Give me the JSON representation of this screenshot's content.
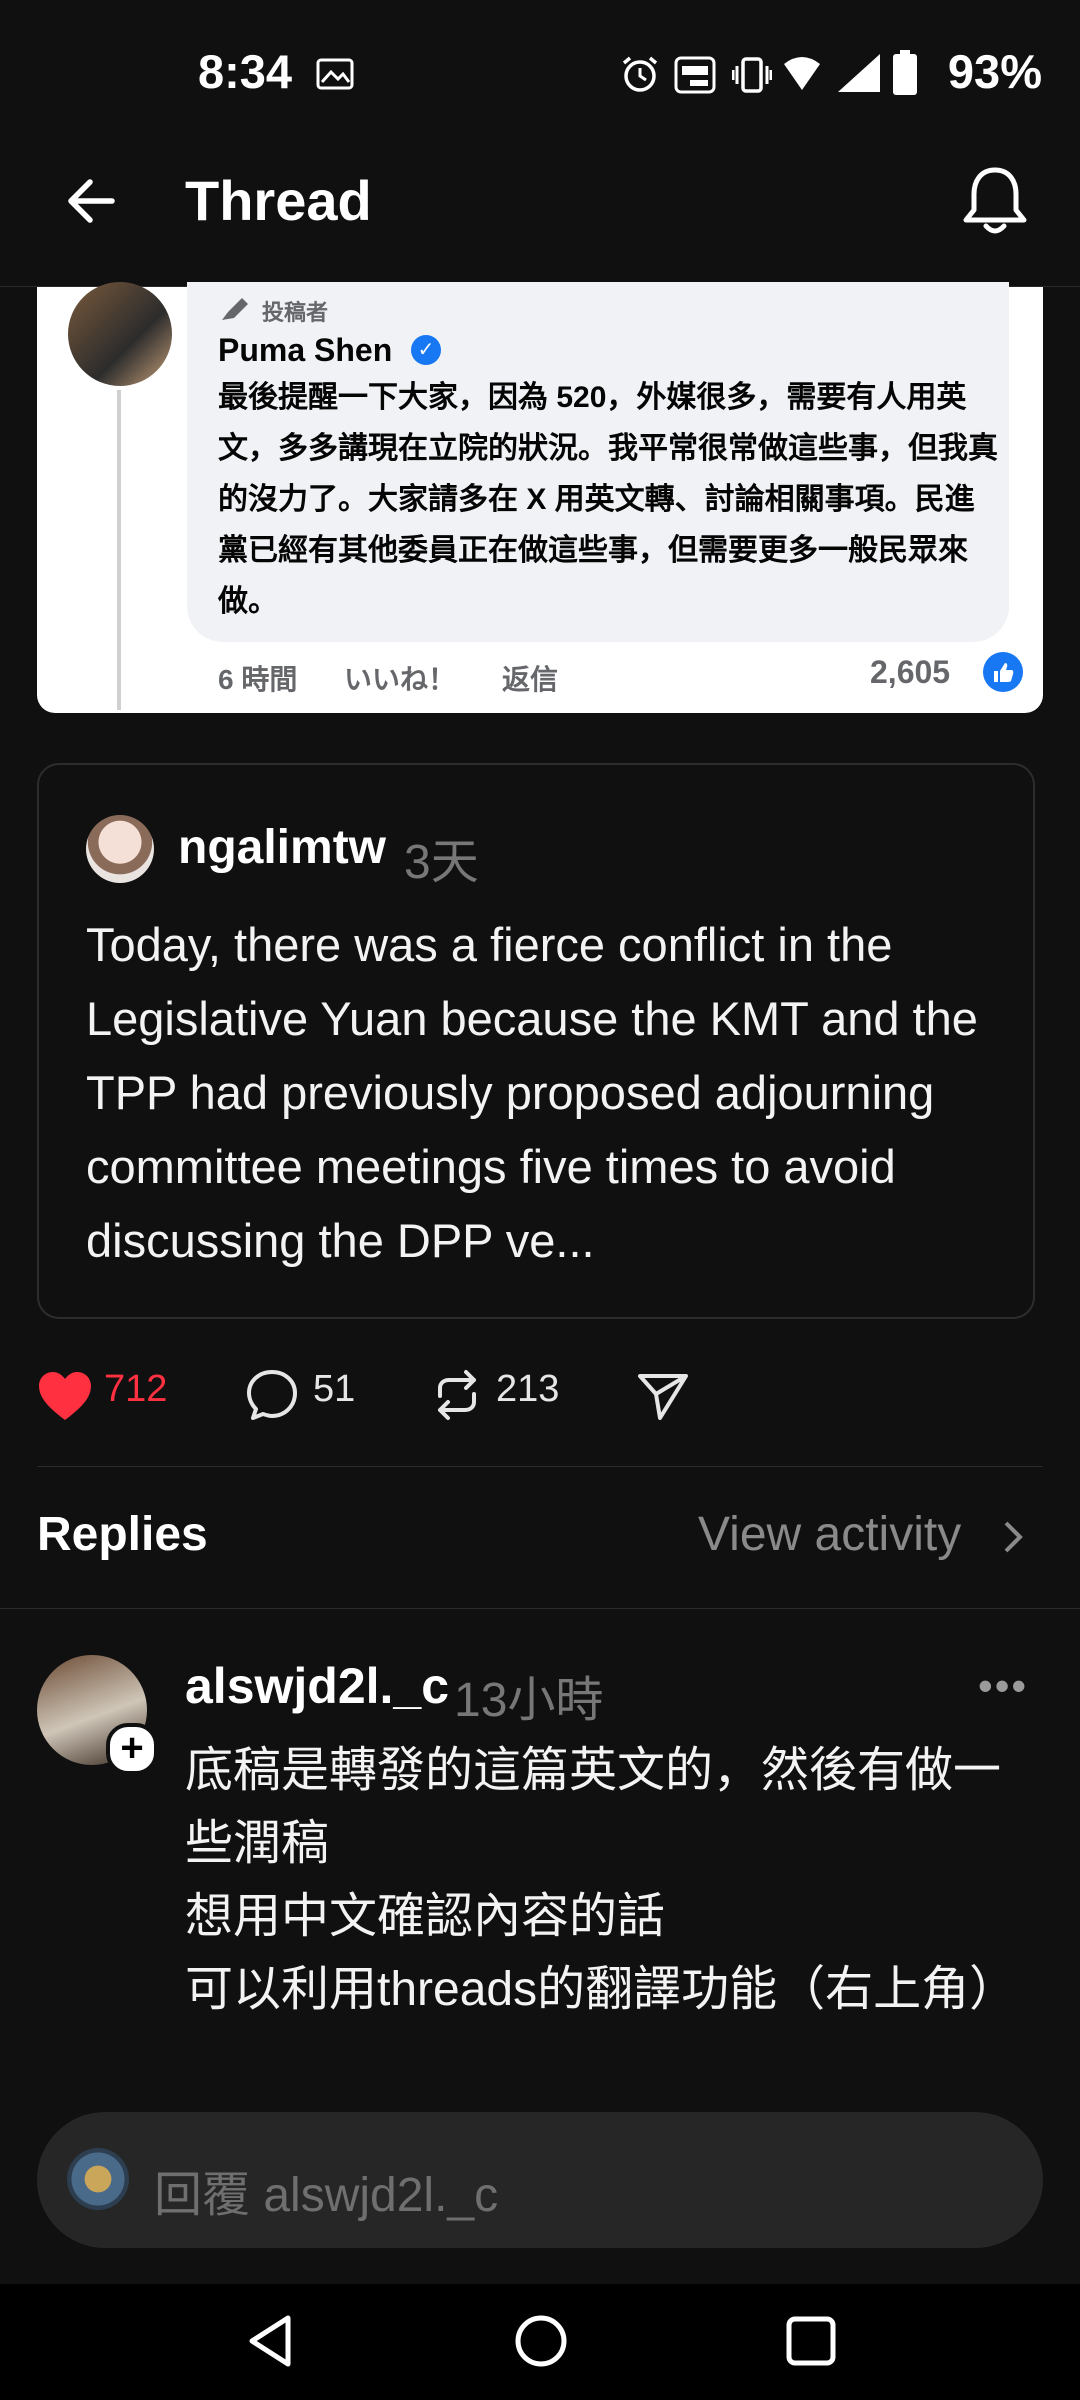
{
  "status_bar": {
    "time": "8:34",
    "battery_percent": "93%",
    "icons": [
      "image-icon",
      "alarm-icon",
      "auto-hz-icon",
      "vibrate-icon",
      "wifi-icon",
      "signal-icon",
      "battery-icon"
    ]
  },
  "app_bar": {
    "title": "Thread",
    "back_icon": "arrow-left-icon",
    "notify_icon": "bell-icon"
  },
  "embedded_post": {
    "poster_tag": "投稿者",
    "name": "Puma Shen",
    "text": "最後提醒一下大家，因為 520，外媒很多，需要有人用英文，多多講現在立院的狀況。我平常很常做這些事，但我真的沒力了。大家請多在 X 用英文轉、討論相關事項。民進黨已經有其他委員正在做這些事，但需要更多一般民眾來做。",
    "time": "6 時間",
    "like_label": "いいね！",
    "reply_label": "返信",
    "reaction_count": "2,605"
  },
  "quoted_post": {
    "username": "ngalimtw",
    "age": "3天",
    "text": "Today, there was a fierce conflict in the Legislative Yuan because the KMT and the TPP had previously proposed adjourning committee meetings five times to avoid discussing the DPP ve..."
  },
  "actions": {
    "likes": "712",
    "comments": "51",
    "reposts": "213",
    "liked": true
  },
  "replies_header": {
    "label": "Replies",
    "view_activity": "View activity"
  },
  "reply": {
    "username": "alswjd2l._c",
    "age": "13小時",
    "more": "•••",
    "lines": [
      "底稿是轉發的這篇英文的，然後有做一些潤稿",
      "想用中文確認內容的話",
      "可以利用threads的翻譯功能（右上角）"
    ]
  },
  "reply_input": {
    "placeholder": "回覆 alswjd2l._c"
  },
  "colors": {
    "background": "#101010",
    "like_red": "#ff3040",
    "verified_blue": "#1877f2"
  }
}
